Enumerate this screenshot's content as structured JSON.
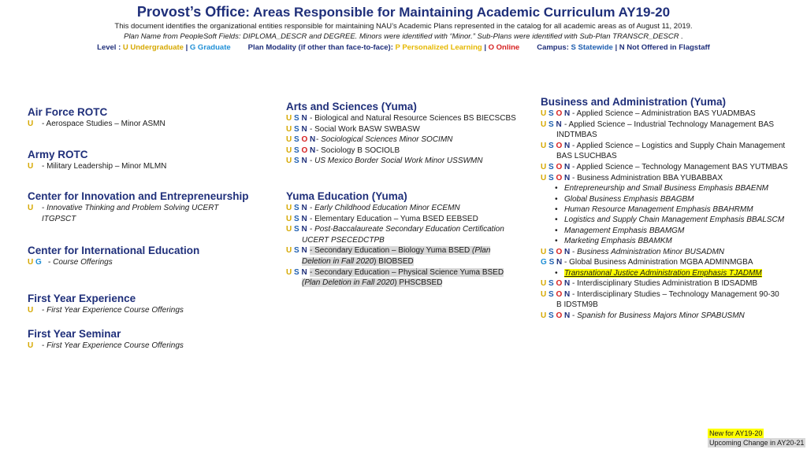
{
  "header": {
    "title_lead": "Provost’s Office",
    "title_rest": ": Areas Responsible for Maintaining Academic Curriculum AY19-20",
    "line1": "This document identifies the organizational entities responsible for maintaining NAU’s Academic Plans represented in the catalog for all academic areas as of August 11, 2019.",
    "line2": "Plan Name from PeopleSoft Fields: DIPLOMA_DESCR and DEGREE.  Minors were identified with “Minor.” Sub-Plans were identified with Sub-Plan TRANSCR_DESCR .",
    "legend": {
      "level_label": "Level : ",
      "level_u": "U Undergraduate",
      "sep": " | ",
      "level_g": "G Graduate",
      "modality_label": "Plan Modality (if other than face-to-face): ",
      "modality_p": "P Personalized Learning",
      "modality_o": "O Online",
      "campus_label": "Campus: ",
      "campus_s": "S Statewide",
      "campus_n": "N Not Offered in Flagstaff"
    }
  },
  "col_a": {
    "afrotc": {
      "title": "Air Force ROTC",
      "i1": " - Aerospace Studies – Minor  ASMN"
    },
    "army": {
      "title": "Army ROTC",
      "i1": " - Military Leadership – Minor  MLMN"
    },
    "cie": {
      "title": "Center for Innovation and Entrepreneurship",
      "i1a": " - ",
      "i1b": "Innovative Thinking and Problem Solving UCERT",
      "i1c": "ITGPSCT"
    },
    "intl": {
      "title": "Center for International Education",
      "i1a": " - ",
      "i1b": "Course Offerings"
    },
    "fye": {
      "title": "First Year Experience",
      "i1a": " - ",
      "i1b": "First Year Experience Course Offerings"
    },
    "fys": {
      "title": "First Year Seminar",
      "i1a": " - ",
      "i1b": "First Year Experience Course Offerings"
    }
  },
  "col_b": {
    "arts": {
      "title": "Arts and Sciences (Yuma)",
      "i1": " - Biological and Natural Resource Sciences BS  BIECSCBS",
      "i2": " - Social Work BASW  SWBASW",
      "i3a": " - ",
      "i3b": "Sociological Sciences Minor  SOCIMN",
      "i4": " - Sociology B  SOCIOLB",
      "i5a": " - ",
      "i5b": "US Mexico Border Social Work Minor  USSWMN"
    },
    "edu": {
      "title": "Yuma Education (Yuma)",
      "i1a": " - ",
      "i1b": "Early Childhood Education Minor  ECEMN",
      "i2": " - Elementary Education – Yuma BSED  EEBSED",
      "i3a": " - ",
      "i3b": "Post-Baccalaureate Secondary Education Certification",
      "i3c": "UCERT  PSECEDCTPB",
      "i4a": " - Secondary Education – Biology Yuma BSED  ",
      "i4b": "(Plan",
      "i4c": "Deletion in Fall 2020",
      "i4d": ") BIOBSED",
      "i5a": " - Secondary Education – Physical Science Yuma BSED ",
      "i5b": "(Plan Deletion in Fall 2020",
      "i5c": ") PHSCBSED"
    }
  },
  "col_c": {
    "biz": {
      "title": "Business and Administration (Yuma)",
      "i1": " - Applied Science – Administration BAS  YUADMBAS",
      "i2a": " - Applied Science – Industrial Technology Management BAS",
      "i2b": "INDTMBAS",
      "i3a": " - Applied Science – Logistics and Supply Chain Management",
      "i3b": "BAS  LSUCHBAS",
      "i4": " - Applied Science – Technology Management BAS  YUTMBAS",
      "i5": " - Business Administration BBA  YUBABBAX",
      "subs": [
        "Entrepreneurship and Small Business Emphasis  BBAENM",
        "Global Business Emphasis  BBAGBM",
        "Human Resource Management Emphasis  BBAHRMM",
        "Logistics and Supply Chain Management Emphasis  BBALSCM",
        "Management Emphasis  BBAMGM",
        "Marketing Emphasis  BBAMKM"
      ],
      "i6a": " - ",
      "i6b": "Business Administration Minor  BUSADMN",
      "i7": " - Global Business Administration MGBA  ADMINMGBA",
      "i7sub": "Transnational Justice Administration Emphasis  TJADMM",
      "i8": " - Interdisciplinary Studies Administration B  IDSADMB",
      "i9a": " - Interdisciplinary Studies – Technology Management 90-30",
      "i9b": "B  IDSTM9B",
      "i10a": " - ",
      "i10b": "Spanish for Business Majors Minor  SPABUSMN"
    }
  },
  "tags": {
    "u": "U",
    "s": "S",
    "o": "O",
    "n": "N",
    "g": "G",
    "bullet": "•"
  },
  "key": {
    "new": "New for AY19-20",
    "change": "Upcoming Change in AY20-21"
  },
  "colors": {
    "title_blue": "#1f2f7a",
    "undergrad_gold": "#d6a800",
    "statewide_blue": "#1f5fb0",
    "online_red": "#d61f1f",
    "graduate_blue": "#1f8fd6",
    "new_yellow": "#ffff00",
    "change_grey": "#d9d9d9"
  }
}
